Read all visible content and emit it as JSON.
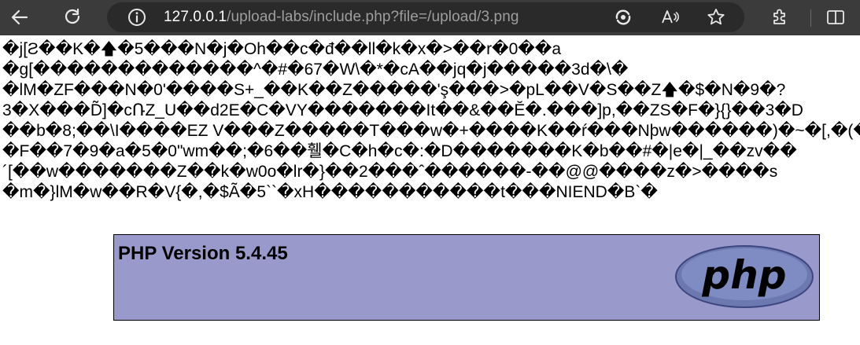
{
  "browser": {
    "url_host": "127.0.0.1",
    "url_path": "/upload-labs/include.php?file=/upload/3.png",
    "icons": {
      "back": "back-arrow-icon",
      "reload": "reload-icon",
      "info": "site-info-icon",
      "install": "install-app-icon",
      "read_aloud": "read-aloud-icon",
      "favorite": "favorite-star-icon",
      "extensions": "extensions-puzzle-icon",
      "split": "split-screen-icon"
    },
    "colors": {
      "toolbar": "#3b3b3b",
      "addressbar": "#2a2a2a"
    }
  },
  "page": {
    "raw_lines": [
      "�j[Ƨ��K�🡅�5���N�j�Oh��c�đ��ll�k�x�>��r�0��a",
      "�g[�������������^�#�67�W\\�*�cA��jq�j�����3d�\\�",
      "�lM�ZF���N�0'����S+_��K��Z�����'ş���>�pL��V�S��Z🡅�$�N�9�?",
      "3�X���D̃]�cՌZ_U��d2E�C�VY�������It��&��Ĕ�.���]p,��ZS�F�}{}��3�D",
      "��b�8;��\\I����EZ V���Z�����T���w�+����K��ŕ���Nþw������)�~�[,�(�h",
      "�F��7�9�a�5�0\"wm��;�6��휄�C�h�c�:�D�������K�b��#�|e�|_��zv��",
      "´[��w�������Z��k�w0o�lr�}��2���ˆ������-��@@����z�>����s",
      "�m�}lM�w��R�V{�,�$Ã�5``�xH�����������t���NIEND�B`�"
    ],
    "php_version_label": "PHP Version 5.4.45",
    "php_logo_text": "php",
    "colors": {
      "php_header_bg": "#9999cc"
    }
  }
}
